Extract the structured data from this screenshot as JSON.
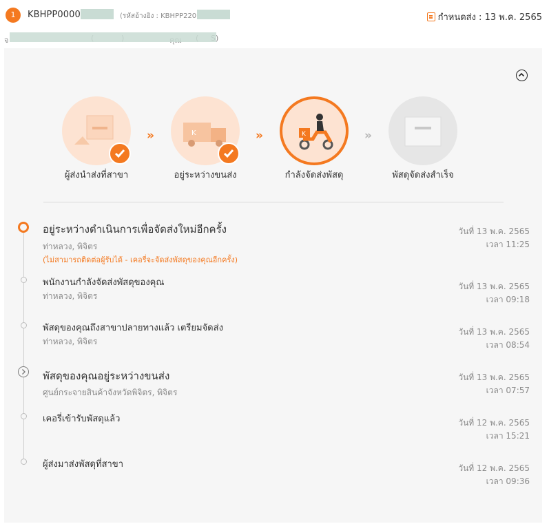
{
  "header": {
    "step_number": "1",
    "tracking_prefix": "KBHPP0000",
    "ref_label": "(รหัสอ้างอิง : KBHPP220",
    "due_label": "กำหนดส่ง : 13 พ.ค. 2565"
  },
  "subheader": {
    "prefix": "จ",
    "visible_fragments": [
      "(",
      ")",
      "คุณ",
      "(",
      "S)"
    ]
  },
  "stages": [
    {
      "label": "ผู้ส่งนำส่งที่สาขา",
      "done": true
    },
    {
      "label": "อยู่ระหว่างขนส่ง",
      "done": true
    },
    {
      "label": "กำลังจัดส่งพัสดุ",
      "active": true
    },
    {
      "label": "พัสดุจัดส่งสำเร็จ",
      "done": false
    }
  ],
  "events": [
    {
      "title": "อยู่ระหว่างดำเนินการเพื่อจัดส่งใหม่อีกครั้ง",
      "location": "ท่าหลวง, พิจิตร",
      "note": "(ไม่สามารถติดต่อผู้รับได้ - เคอรี่จะจัดส่งพัสดุของคุณอีกครั้ง)",
      "date": "วันที่ 13 พ.ค. 2565",
      "time": "เวลา 11:25"
    },
    {
      "title": "พนักงานกำลังจัดส่งพัสดุของคุณ",
      "location": "ท่าหลวง, พิจิตร",
      "date": "วันที่ 13 พ.ค. 2565",
      "time": "เวลา 09:18"
    },
    {
      "title": "พัสดุของคุณถึงสาขาปลายทางแล้ว เตรียมจัดส่ง",
      "location": "ท่าหลวง, พิจิตร",
      "date": "วันที่ 13 พ.ค. 2565",
      "time": "เวลา 08:54"
    },
    {
      "title": "พัสดุของคุณอยู่ระหว่างขนส่ง",
      "location": "ศูนย์กระจายสินค้าจังหวัดพิจิตร, พิจิตร",
      "date": "วันที่ 13 พ.ค. 2565",
      "time": "เวลา 07:57"
    },
    {
      "title": "เคอรี่เข้ารับพัสดุแล้ว",
      "location": "",
      "date": "วันที่ 12 พ.ค. 2565",
      "time": "เวลา 15:21"
    },
    {
      "title": "ผู้ส่งมาส่งพัสดุที่สาขา",
      "location": "",
      "date": "วันที่ 12 พ.ค. 2565",
      "time": "เวลา 09:36"
    }
  ],
  "colors": {
    "accent": "#f47920",
    "muted": "#8a8a8a",
    "panel": "#f6f6f6"
  },
  "icons": [
    "calendar-icon",
    "chevron-up-icon",
    "check-icon",
    "chevron-right-icon"
  ]
}
